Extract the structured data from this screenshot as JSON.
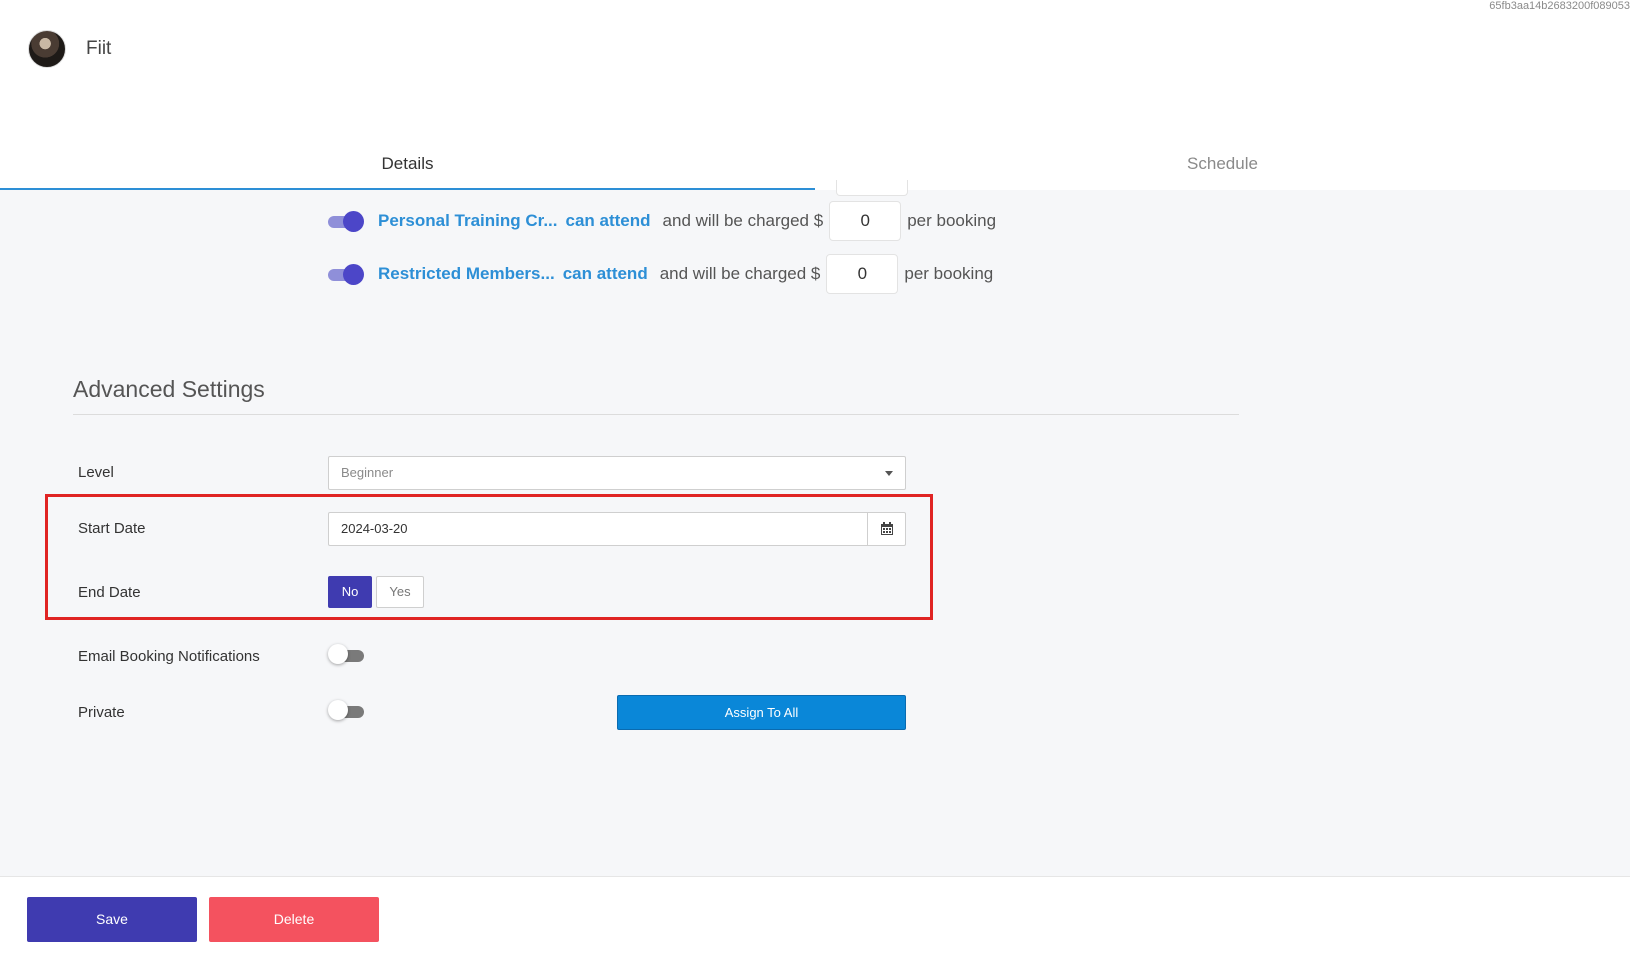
{
  "top_id": "65fb3aa14b2683200f089053",
  "header": {
    "brand": "Fiit",
    "avatar_icon": "avatar"
  },
  "tabs": [
    {
      "label": "Details",
      "active": true
    },
    {
      "label": "Schedule",
      "active": false
    }
  ],
  "access": [
    {
      "name": "Personal Training Cr...",
      "can_attend": "can attend",
      "charged": "and will be charged $",
      "price": "0",
      "per": "per booking"
    },
    {
      "name": "Restricted Members...",
      "can_attend": "can attend",
      "charged": "and will be charged $",
      "price": "0",
      "per": "per booking"
    }
  ],
  "advanced": {
    "title": "Advanced Settings",
    "level": {
      "label": "Level",
      "value": "Beginner"
    },
    "start_date": {
      "label": "Start Date",
      "value": "2024-03-20",
      "icon": "calendar-icon"
    },
    "end_date": {
      "label": "End Date",
      "no": "No",
      "yes": "Yes",
      "selected": "No"
    },
    "email_notifications": {
      "label": "Email Booking Notifications",
      "enabled": false
    },
    "private": {
      "label": "Private",
      "enabled": false
    },
    "assign_all": "Assign To All"
  },
  "footer": {
    "save": "Save",
    "delete": "Delete"
  },
  "colors": {
    "primary": "#3f3bb0",
    "link": "#2d8fd6",
    "danger": "#f4525f",
    "assign": "#0a87d8",
    "highlight": "#e02424"
  }
}
